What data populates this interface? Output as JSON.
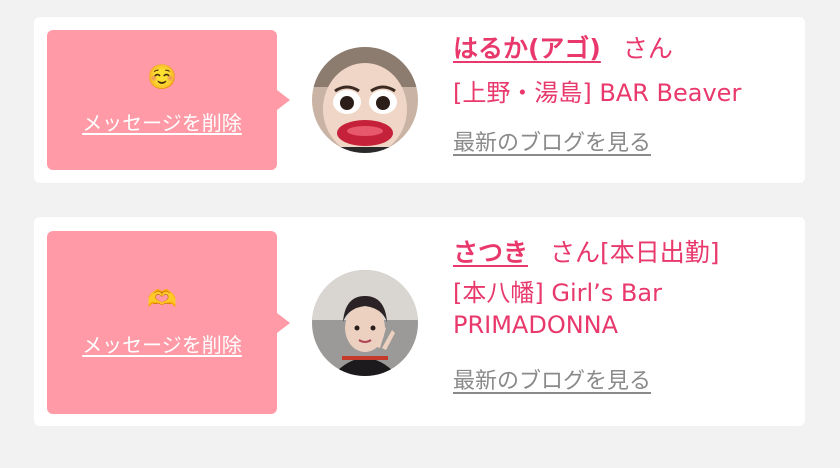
{
  "messages": [
    {
      "emoji": "☺️",
      "delete_label": "メッセージを削除",
      "name": "はるか(アゴ)",
      "honorific": "さん",
      "status": "",
      "shop": "[上野・湯島] BAR Beaver",
      "blog_label": "最新のブログを見る",
      "avatar_icon": "avatar-photo"
    },
    {
      "emoji": "🫶",
      "delete_label": "メッセージを削除",
      "name": "さつき",
      "honorific": "さん",
      "status": "[本日出勤]",
      "shop": "[本八幡] Girl’s Bar PRIMADONNA",
      "blog_label": "最新のブログを見る",
      "avatar_icon": "avatar-photo"
    }
  ],
  "colors": {
    "accent": "#e8386c",
    "bubble": "#ff9aa6",
    "background": "#f2f2f3",
    "muted": "#8a8a8a"
  }
}
